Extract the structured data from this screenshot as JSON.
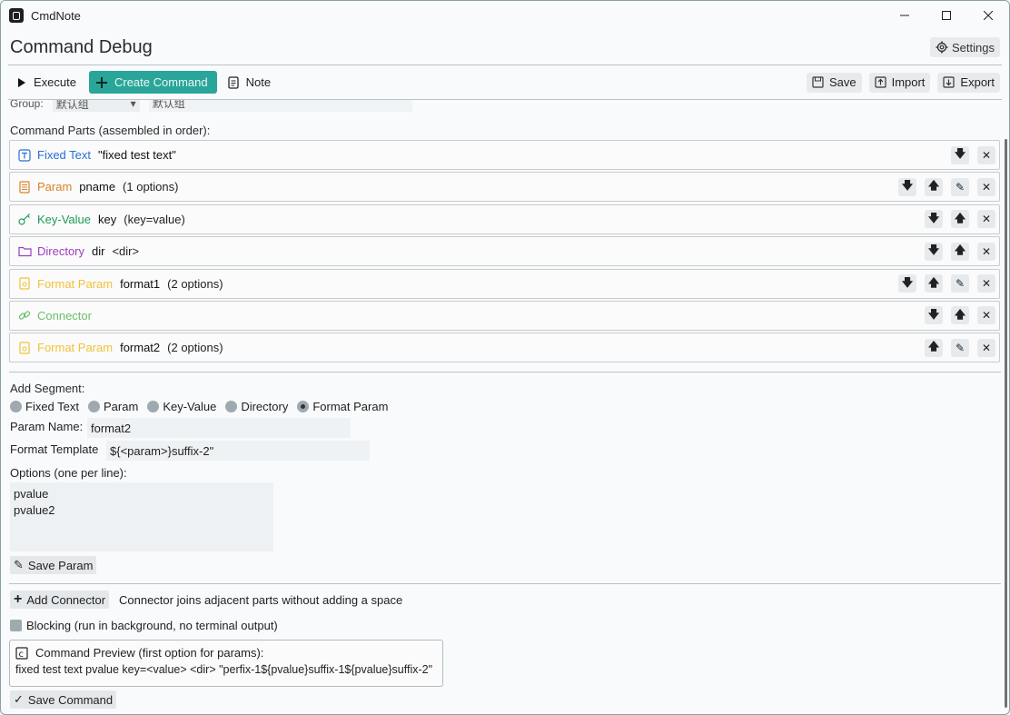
{
  "app": {
    "title": "CmdNote",
    "window_controls": [
      "—",
      "☐",
      "✕"
    ]
  },
  "page": {
    "title": "Command Debug",
    "settings_label": "Settings"
  },
  "toolbar": {
    "execute_label": "Execute",
    "create_label": "Create Command",
    "note_label": "Note",
    "save_label": "Save",
    "import_label": "Import",
    "export_label": "Export",
    "accent_color": "#2aa59a"
  },
  "group": {
    "label": "Group:",
    "select_value": "默认组",
    "input_value": "默认组"
  },
  "parts_header": "Command Parts (assembled in order):",
  "parts": [
    {
      "type": "Fixed Text",
      "name": "\"fixed test text\"",
      "extra": "",
      "color": "#2a6fd6",
      "icon": "text-icon"
    },
    {
      "type": "Param",
      "name": "pname",
      "extra": "(1 options)",
      "color": "#d9822b",
      "icon": "list-icon"
    },
    {
      "type": "Key-Value",
      "name": "key",
      "extra": "(key=value)",
      "color": "#1e9b57",
      "icon": "key-icon"
    },
    {
      "type": "Directory",
      "name": "dir",
      "extra": "<dir>",
      "color": "#9b3fbf",
      "icon": "folder-icon"
    },
    {
      "type": "Format Param",
      "name": "format1",
      "extra": "(2 options)",
      "color": "#f0c23a",
      "icon": "format-icon"
    },
    {
      "type": "Connector",
      "name": "",
      "extra": "",
      "color": "#6bbf6b",
      "icon": "link-icon"
    },
    {
      "type": "Format Param",
      "name": "format2",
      "extra": "(2 options)",
      "color": "#f0c23a",
      "icon": "format-icon"
    }
  ],
  "add_segment": {
    "label": "Add Segment:",
    "options": [
      "Fixed Text",
      "Param",
      "Key-Value",
      "Directory",
      "Format Param"
    ],
    "selected": "Format Param"
  },
  "form": {
    "param_name_label": "Param Name:",
    "param_name_value": "format2",
    "format_template_label": "Format Template",
    "format_template_value": "${<param>}suffix-2\"",
    "options_label": "Options (one per line):",
    "options_value": "pvalue\npvalue2",
    "save_param_label": "Save Param"
  },
  "connector": {
    "add_label": "Add Connector",
    "hint": "Connector joins adjacent parts without adding a space"
  },
  "blocking_label": "Blocking (run in background, no terminal output)",
  "preview": {
    "title": "Command Preview (first option for params):",
    "text": "fixed test text pvalue key=<value> <dir> \"perfix-1${pvalue}suffix-1${pvalue}suffix-2\""
  },
  "save_command_label": "Save Command"
}
